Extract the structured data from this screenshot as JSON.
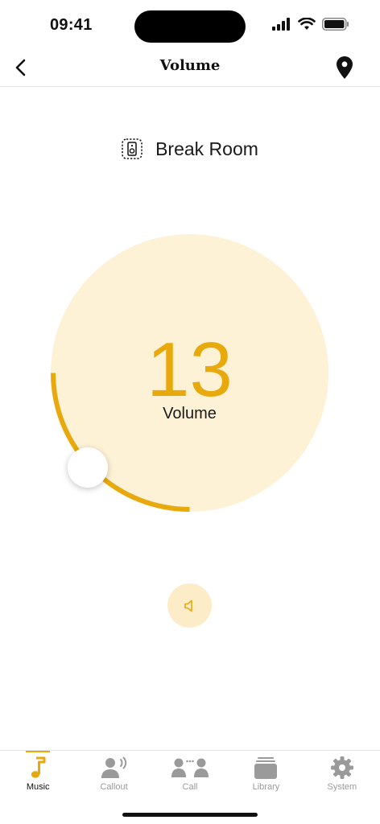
{
  "status": {
    "time": "09:41"
  },
  "nav": {
    "title": "Volume"
  },
  "zone": {
    "label": "Break Room"
  },
  "volume": {
    "value": "13",
    "label": "Volume",
    "level_fraction": 0.25
  },
  "colors": {
    "accent": "#e8a90c",
    "dial_bg": "#fdf1d6",
    "mute_bg": "#fdecc8",
    "inactive": "#9a9a9a"
  },
  "tabs": [
    {
      "label": "Music",
      "icon": "music-note-icon",
      "active": true
    },
    {
      "label": "Callout",
      "icon": "callout-icon",
      "active": false
    },
    {
      "label": "Call",
      "icon": "call-icon",
      "active": false
    },
    {
      "label": "Library",
      "icon": "library-icon",
      "active": false
    },
    {
      "label": "System",
      "icon": "gear-icon",
      "active": false
    }
  ]
}
